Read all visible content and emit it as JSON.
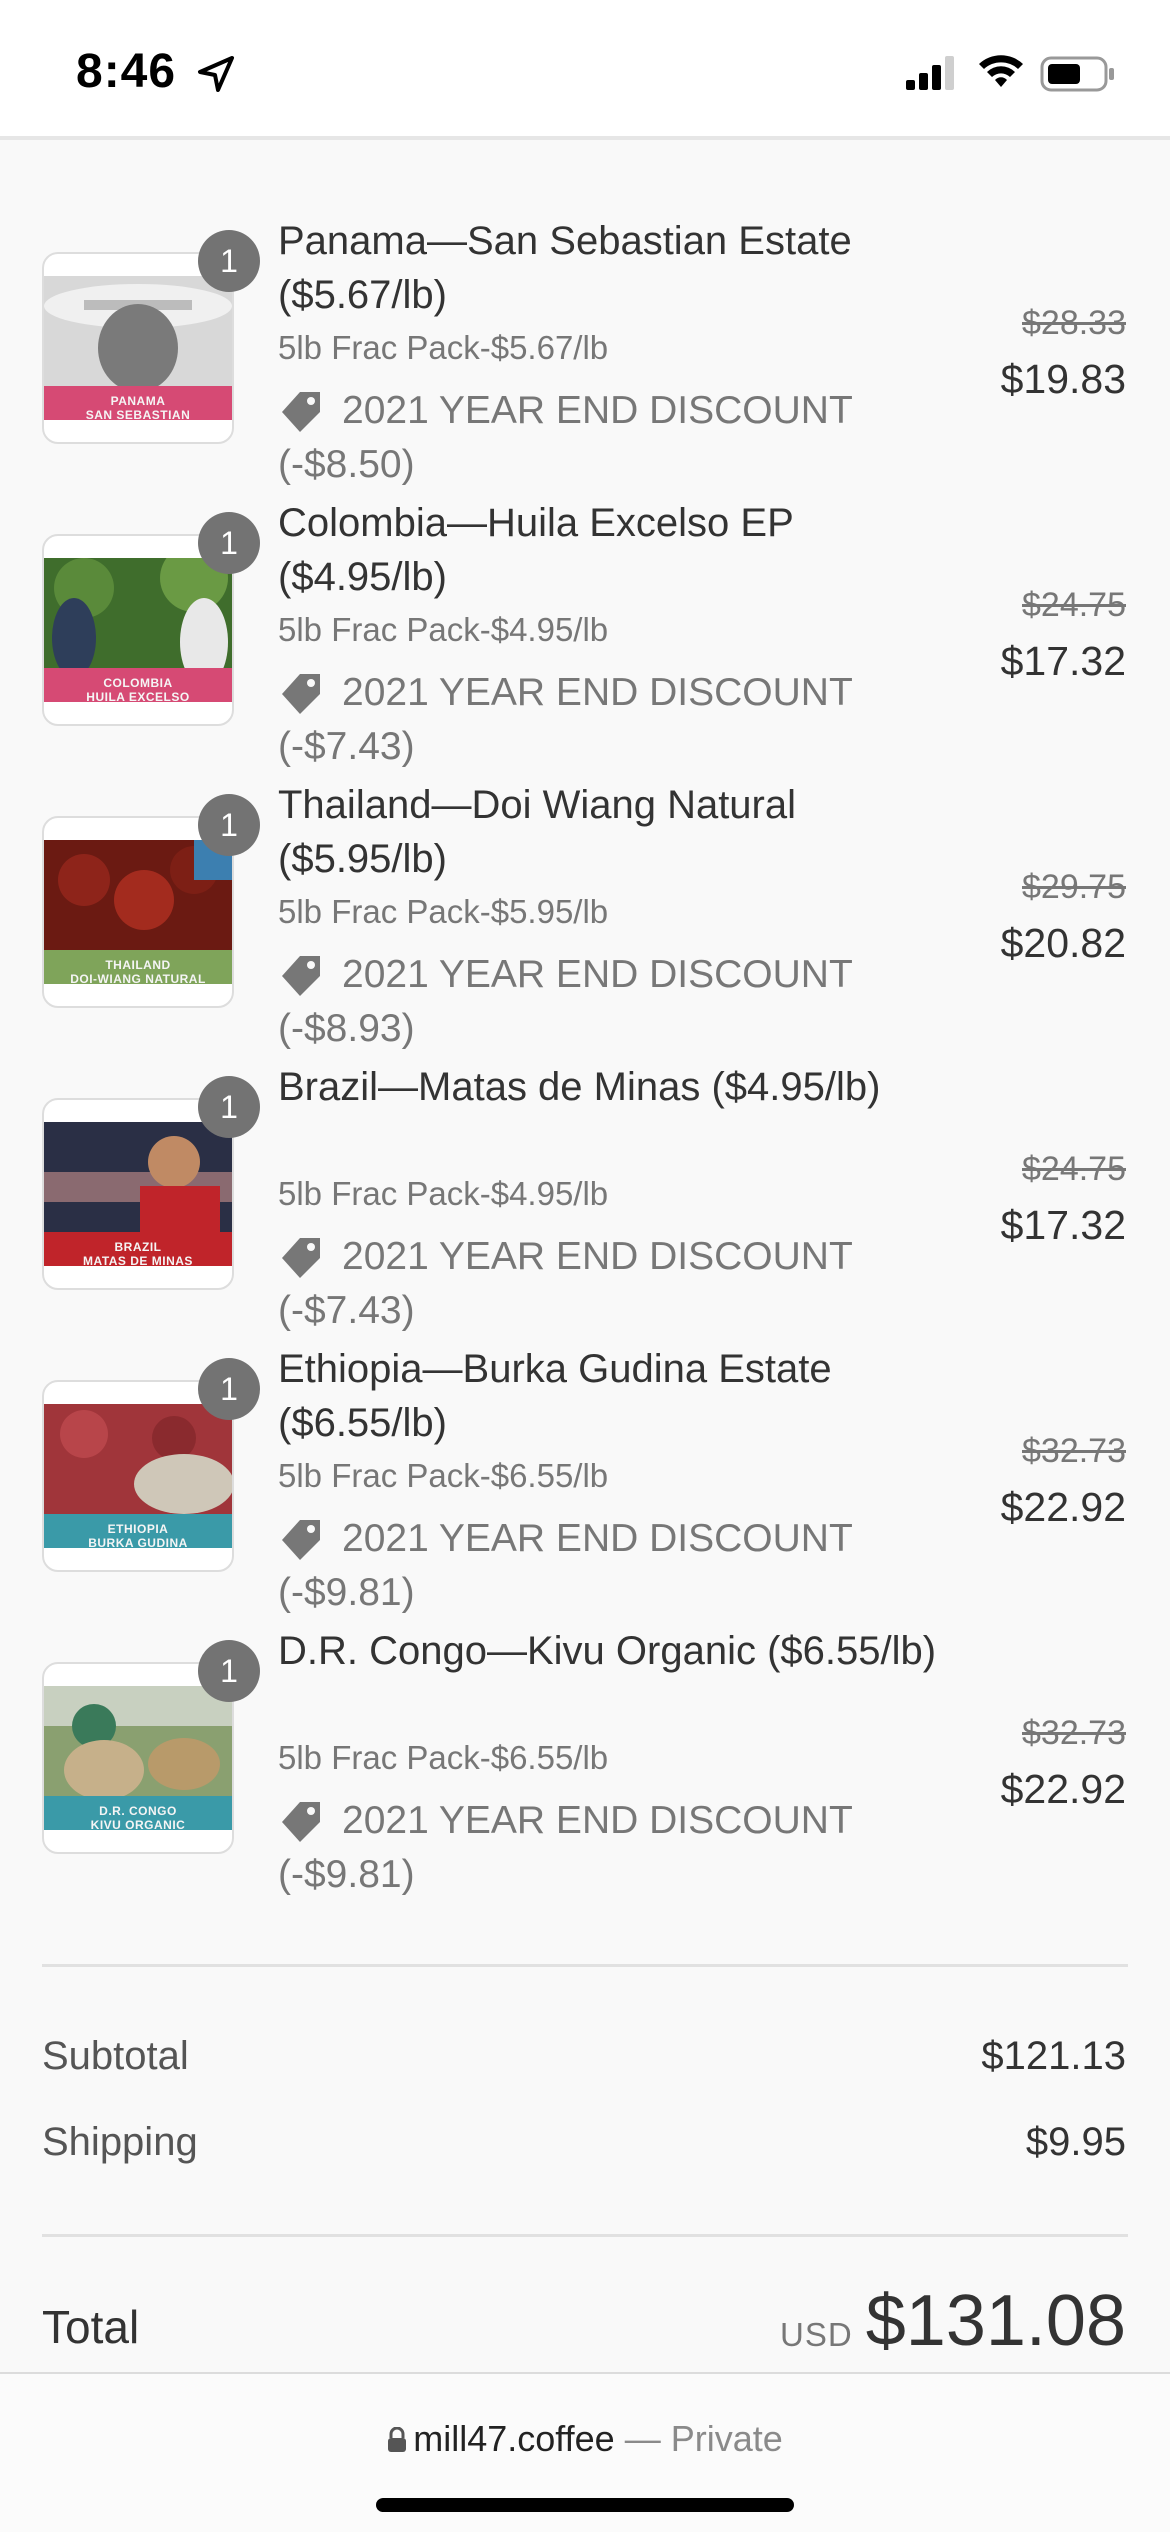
{
  "status_bar": {
    "time": "8:46"
  },
  "items": [
    {
      "qty": "1",
      "title": "Panama—San Sebastian Estate ($5.67/lb)",
      "variant": "5lb Frac Pack-$5.67/lb",
      "discount": "2021 YEAR END DISCOUNT (-$8.50)",
      "original_price": "$28.33",
      "final_price": "$19.83",
      "thumb_caption": [
        "PANAMA",
        "SAN SEBASTIAN"
      ]
    },
    {
      "qty": "1",
      "title": "Colombia—Huila Excelso EP ($4.95/lb)",
      "variant": "5lb Frac Pack-$4.95/lb",
      "discount": "2021 YEAR END DISCOUNT (-$7.43)",
      "original_price": "$24.75",
      "final_price": "$17.32",
      "thumb_caption": [
        "COLOMBIA",
        "HUILA EXCELSO"
      ]
    },
    {
      "qty": "1",
      "title": "Thailand—Doi Wiang Natural ($5.95/lb)",
      "variant": "5lb Frac Pack-$5.95/lb",
      "discount": "2021 YEAR END DISCOUNT (-$8.93)",
      "original_price": "$29.75",
      "final_price": "$20.82",
      "thumb_caption": [
        "THAILAND",
        "DOI-WIANG NATURAL"
      ]
    },
    {
      "qty": "1",
      "title": "Brazil—Matas de Minas ($4.95/lb)",
      "variant": "5lb Frac Pack-$4.95/lb",
      "discount": "2021 YEAR END DISCOUNT (-$7.43)",
      "original_price": "$24.75",
      "final_price": "$17.32",
      "thumb_caption": [
        "BRAZIL",
        "MATAS DE MINAS"
      ]
    },
    {
      "qty": "1",
      "title": "Ethiopia—Burka Gudina Estate ($6.55/lb)",
      "variant": "5lb Frac Pack-$6.55/lb",
      "discount": "2021 YEAR END DISCOUNT (-$9.81)",
      "original_price": "$32.73",
      "final_price": "$22.92",
      "thumb_caption": [
        "ETHIOPIA",
        "BURKA GUDINA"
      ]
    },
    {
      "qty": "1",
      "title": "D.R. Congo—Kivu Organic ($6.55/lb)",
      "variant": "5lb Frac Pack-$6.55/lb",
      "discount": "2021 YEAR END DISCOUNT (-$9.81)",
      "original_price": "$32.73",
      "final_price": "$22.92",
      "thumb_caption": [
        "D.R. CONGO",
        "KIVU ORGANIC"
      ]
    }
  ],
  "summary": {
    "subtotal_label": "Subtotal",
    "subtotal_value": "$121.13",
    "shipping_label": "Shipping",
    "shipping_value": "$9.95",
    "total_label": "Total",
    "total_currency": "USD",
    "total_value": "$131.08"
  },
  "browser": {
    "domain": "mill47.coffee",
    "mode": " — Private"
  },
  "colors": {
    "qty_badge": "#737373",
    "text_primary": "#333333",
    "text_secondary": "#777777",
    "caption_pink": "#d64a74",
    "caption_teal": "#3a9aa8"
  }
}
